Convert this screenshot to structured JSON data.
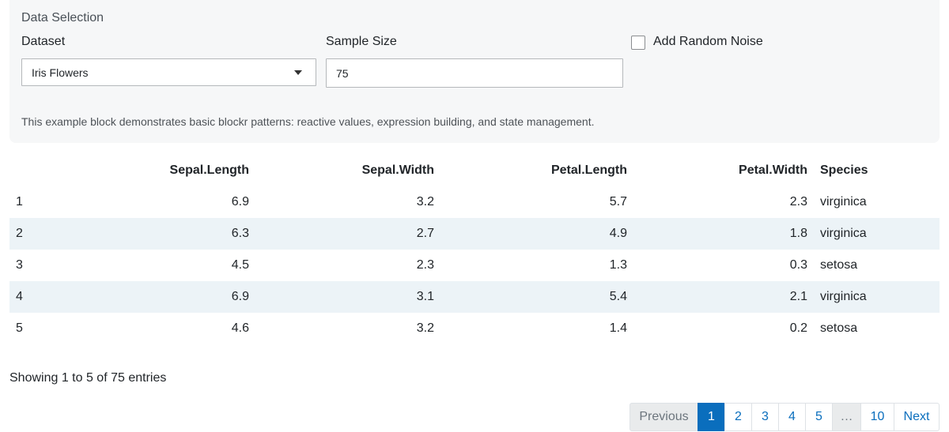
{
  "panel": {
    "title": "Data Selection",
    "dataset": {
      "label": "Dataset",
      "selected": "Iris Flowers"
    },
    "sample_size": {
      "label": "Sample Size",
      "value": "75"
    },
    "noise": {
      "label": "Add Random Noise",
      "checked": false
    },
    "description": "This example block demonstrates basic blockr patterns: reactive values, expression building, and state management."
  },
  "table": {
    "headers": [
      "",
      "Sepal.Length",
      "Sepal.Width",
      "Petal.Length",
      "Petal.Width",
      "Species"
    ],
    "rows": [
      [
        "1",
        "6.9",
        "3.2",
        "5.7",
        "2.3",
        "virginica"
      ],
      [
        "2",
        "6.3",
        "2.7",
        "4.9",
        "1.8",
        "virginica"
      ],
      [
        "3",
        "4.5",
        "2.3",
        "1.3",
        "0.3",
        "setosa"
      ],
      [
        "4",
        "6.9",
        "3.1",
        "5.4",
        "2.1",
        "virginica"
      ],
      [
        "5",
        "4.6",
        "3.2",
        "1.4",
        "0.2",
        "setosa"
      ]
    ]
  },
  "info": "Showing 1 to 5 of 75 entries",
  "pagination": {
    "previous": "Previous",
    "pages": [
      "1",
      "2",
      "3",
      "4",
      "5"
    ],
    "ellipsis": "…",
    "last_page": "10",
    "next": "Next",
    "current": "1"
  }
}
